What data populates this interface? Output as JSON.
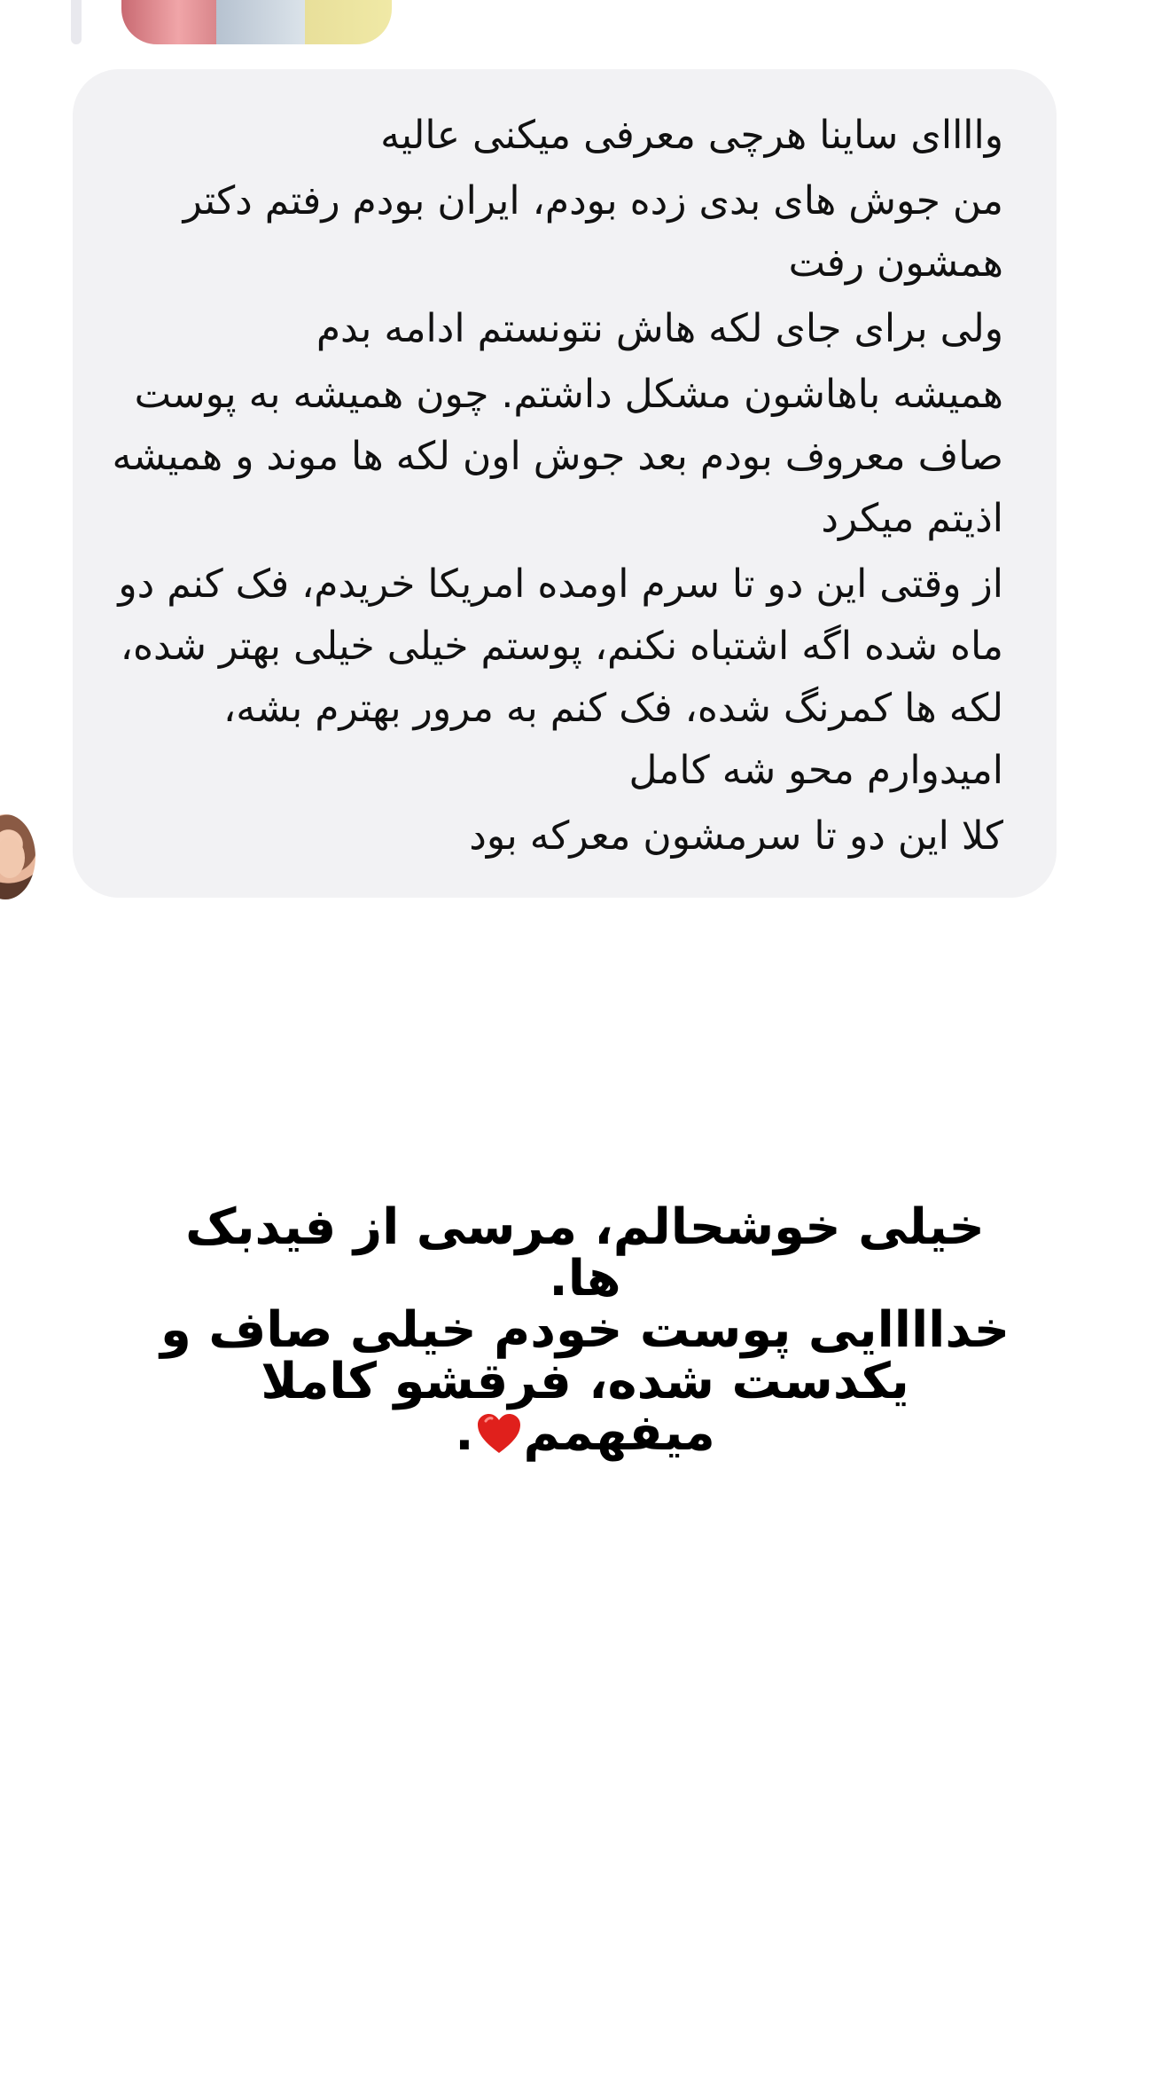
{
  "message": {
    "paragraphs": [
      "واااای ساینا هرچی معرفی میکنی عالیه",
      "من جوش های بدی زده بودم، ایران بودم رفتم دکتر همشون رفت",
      "ولی برای جای لکه هاش نتونستم ادامه بدم",
      "همیشه باهاشون مشکل داشتم. چون همیشه به پوست صاف معروف بودم بعد جوش اون لکه ها موند و همیشه اذیتم میکرد",
      "از وقتی این دو تا سرم اومده امریکا خریدم، فک کنم دو ماه شده اگه اشتباه نکنم، پوستم خیلی خیلی بهتر شده، لکه ها کمرنگ شده، فک کنم به مرور بهترم بشه، امیدوارم محو شه کامل",
      "کلا این دو تا سرمشون معرکه بود"
    ]
  },
  "caption": {
    "line1": "خیلی خوشحالم، مرسی از فیدبک ها.",
    "line2": "خداااایی پوست خودم خیلی صاف و",
    "line3": "یکدست شده، فرقشو کاملا میفهمم",
    "line3_end": ".",
    "heart_color": "#e0201c"
  },
  "icons": {
    "heart": "red-heart-icon",
    "avatar": "user-avatar"
  },
  "colors": {
    "bubble": "#f2f2f4",
    "background": "#ffffff",
    "text": "#111111"
  }
}
